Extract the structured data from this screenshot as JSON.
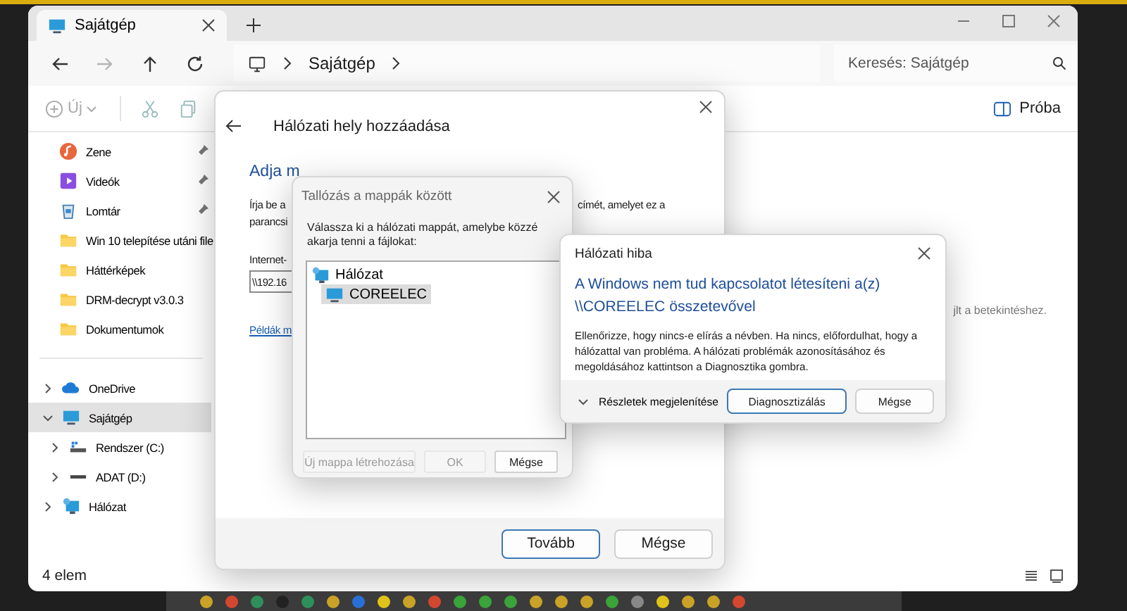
{
  "explorer": {
    "tabs": [
      {
        "label": "Sajátgép",
        "selected": true
      }
    ],
    "nav_buttons": [
      {
        "kind": "back",
        "disabled": false
      },
      {
        "kind": "forward",
        "disabled": true
      },
      {
        "kind": "up",
        "disabled": false
      },
      {
        "kind": "refresh",
        "disabled": false
      }
    ],
    "breadcrumb": [
      "Sajátgép"
    ],
    "search": {
      "placeholder": "Keresés: Sajátgép"
    },
    "toolbar": {
      "new_label": "Új",
      "right_label": "Próba"
    },
    "quick_access": [
      {
        "label": "Zene",
        "kind": "music",
        "pinned": true
      },
      {
        "label": "Videók",
        "kind": "video",
        "pinned": true
      },
      {
        "label": "Lomtár",
        "kind": "bin",
        "pinned": true
      },
      {
        "label": "Win 10 telepítése utáni file",
        "kind": "folder",
        "pinned": false
      },
      {
        "label": "Háttérképek",
        "kind": "folder",
        "pinned": false
      },
      {
        "label": "DRM-decrypt v3.0.3",
        "kind": "folder",
        "pinned": false
      },
      {
        "label": "Dokumentumok",
        "kind": "folder",
        "pinned": false
      }
    ],
    "tree": [
      {
        "label": "OneDrive",
        "kind": "cloud",
        "expanded": false,
        "selected": false
      },
      {
        "label": "Sajátgép",
        "kind": "pc",
        "expanded": true,
        "selected": true,
        "children": [
          {
            "label": "Rendszer (C:)",
            "kind": "system-drive",
            "expanded": false,
            "selected": false
          },
          {
            "label": "ADAT (D:)",
            "kind": "drive",
            "expanded": false,
            "selected": false
          }
        ]
      },
      {
        "label": "Hálózat",
        "kind": "network",
        "expanded": false,
        "selected": false
      }
    ],
    "content_hint": "jlt a betekintéshez.",
    "status_bar": "4 elem"
  },
  "add_location_dialog": {
    "title": "Hálózati hely hozzáadása",
    "heading": "Adja m",
    "text_left": [
      "Írja be a",
      "parancsi"
    ],
    "text_right": "címét, amelyet ez a",
    "field_label": "Internet-",
    "field_value": "\\\\192.16",
    "link": "Példák m",
    "buttons": [
      {
        "label": "Tovább",
        "default": true
      },
      {
        "label": "Mégse",
        "default": false
      }
    ]
  },
  "browse_dialog": {
    "title": "Tallózás a mappák között",
    "instruction": "Válassza ki a hálózati mappát, amelybe közzé akarja tenni a fájlokat:",
    "tree": [
      {
        "label": "Hálózat",
        "kind": "network",
        "selected": false,
        "children": [
          {
            "label": "COREELEC",
            "kind": "pc",
            "selected": true
          }
        ]
      }
    ],
    "buttons": [
      {
        "label": "Új mappa létrehozása",
        "disabled": true
      },
      {
        "label": "OK",
        "disabled": true
      },
      {
        "label": "Mégse",
        "disabled": false
      }
    ]
  },
  "error_dialog": {
    "title": "Hálózati hiba",
    "heading": "A Windows nem tud kapcsolatot létesíteni a(z) \\\\COREELEC összetevővel",
    "body": "Ellenőrizze, hogy nincs-e elírás a névben. Ha nincs, előfordulhat, hogy a hálózattal van probléma. A hálózati problémák azonosításához és megoldásához kattintson a Diagnosztika gombra.",
    "details": {
      "label": "Részletek megjelenítése",
      "expanded": false
    },
    "buttons": [
      {
        "label": "Diagnosztizálás",
        "default": true
      },
      {
        "label": "Mégse",
        "default": false
      }
    ]
  }
}
